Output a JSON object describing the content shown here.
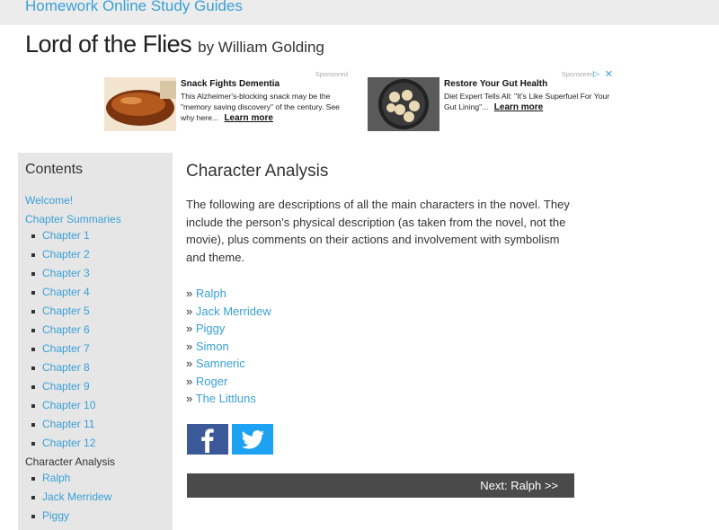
{
  "header": {
    "site_name": "Homework Online Study Guides",
    "book_title": "Lord of the Flies",
    "author": "by William Golding"
  },
  "ads": [
    {
      "headline": "Snack Fights Dementia",
      "body": "This Alzheimer's-blocking snack may be the \"memory saving discovery\" of the century. See why here...",
      "cta": "Learn more",
      "sponsored": "Sponsored"
    },
    {
      "headline": "Restore Your Gut Health",
      "body": "Diet Expert Tells All: \"It's Like Superfuel For Your Gut Lining\"...",
      "cta": "Learn more",
      "sponsored": "Sponsored"
    }
  ],
  "sidebar": {
    "heading": "Contents",
    "welcome": "Welcome!",
    "chapter_summaries": "Chapter Summaries",
    "chapters": [
      "Chapter 1",
      "Chapter 2",
      "Chapter 3",
      "Chapter 4",
      "Chapter 5",
      "Chapter 6",
      "Chapter 7",
      "Chapter 8",
      "Chapter 9",
      "Chapter 10",
      "Chapter 11",
      "Chapter 12"
    ],
    "character_analysis": "Character Analysis",
    "characters": [
      "Ralph",
      "Jack Merridew",
      "Piggy"
    ]
  },
  "main": {
    "title": "Character Analysis",
    "intro": "The following are descriptions of all the main characters in the novel. They include the person's physical description (as taken from the novel, not the movie), plus comments on their actions and involvement with symbolism and theme.",
    "bullet": "»",
    "characters": [
      "Ralph",
      "Jack Merridew",
      "Piggy",
      "Simon",
      "Samneric",
      "Roger",
      "The Littluns"
    ],
    "next_label": "Next: Ralph >>"
  },
  "colors": {
    "link": "#39a0d6",
    "facebook": "#3b5998",
    "twitter": "#1da1f2",
    "next_bar": "#4a4a4a"
  }
}
